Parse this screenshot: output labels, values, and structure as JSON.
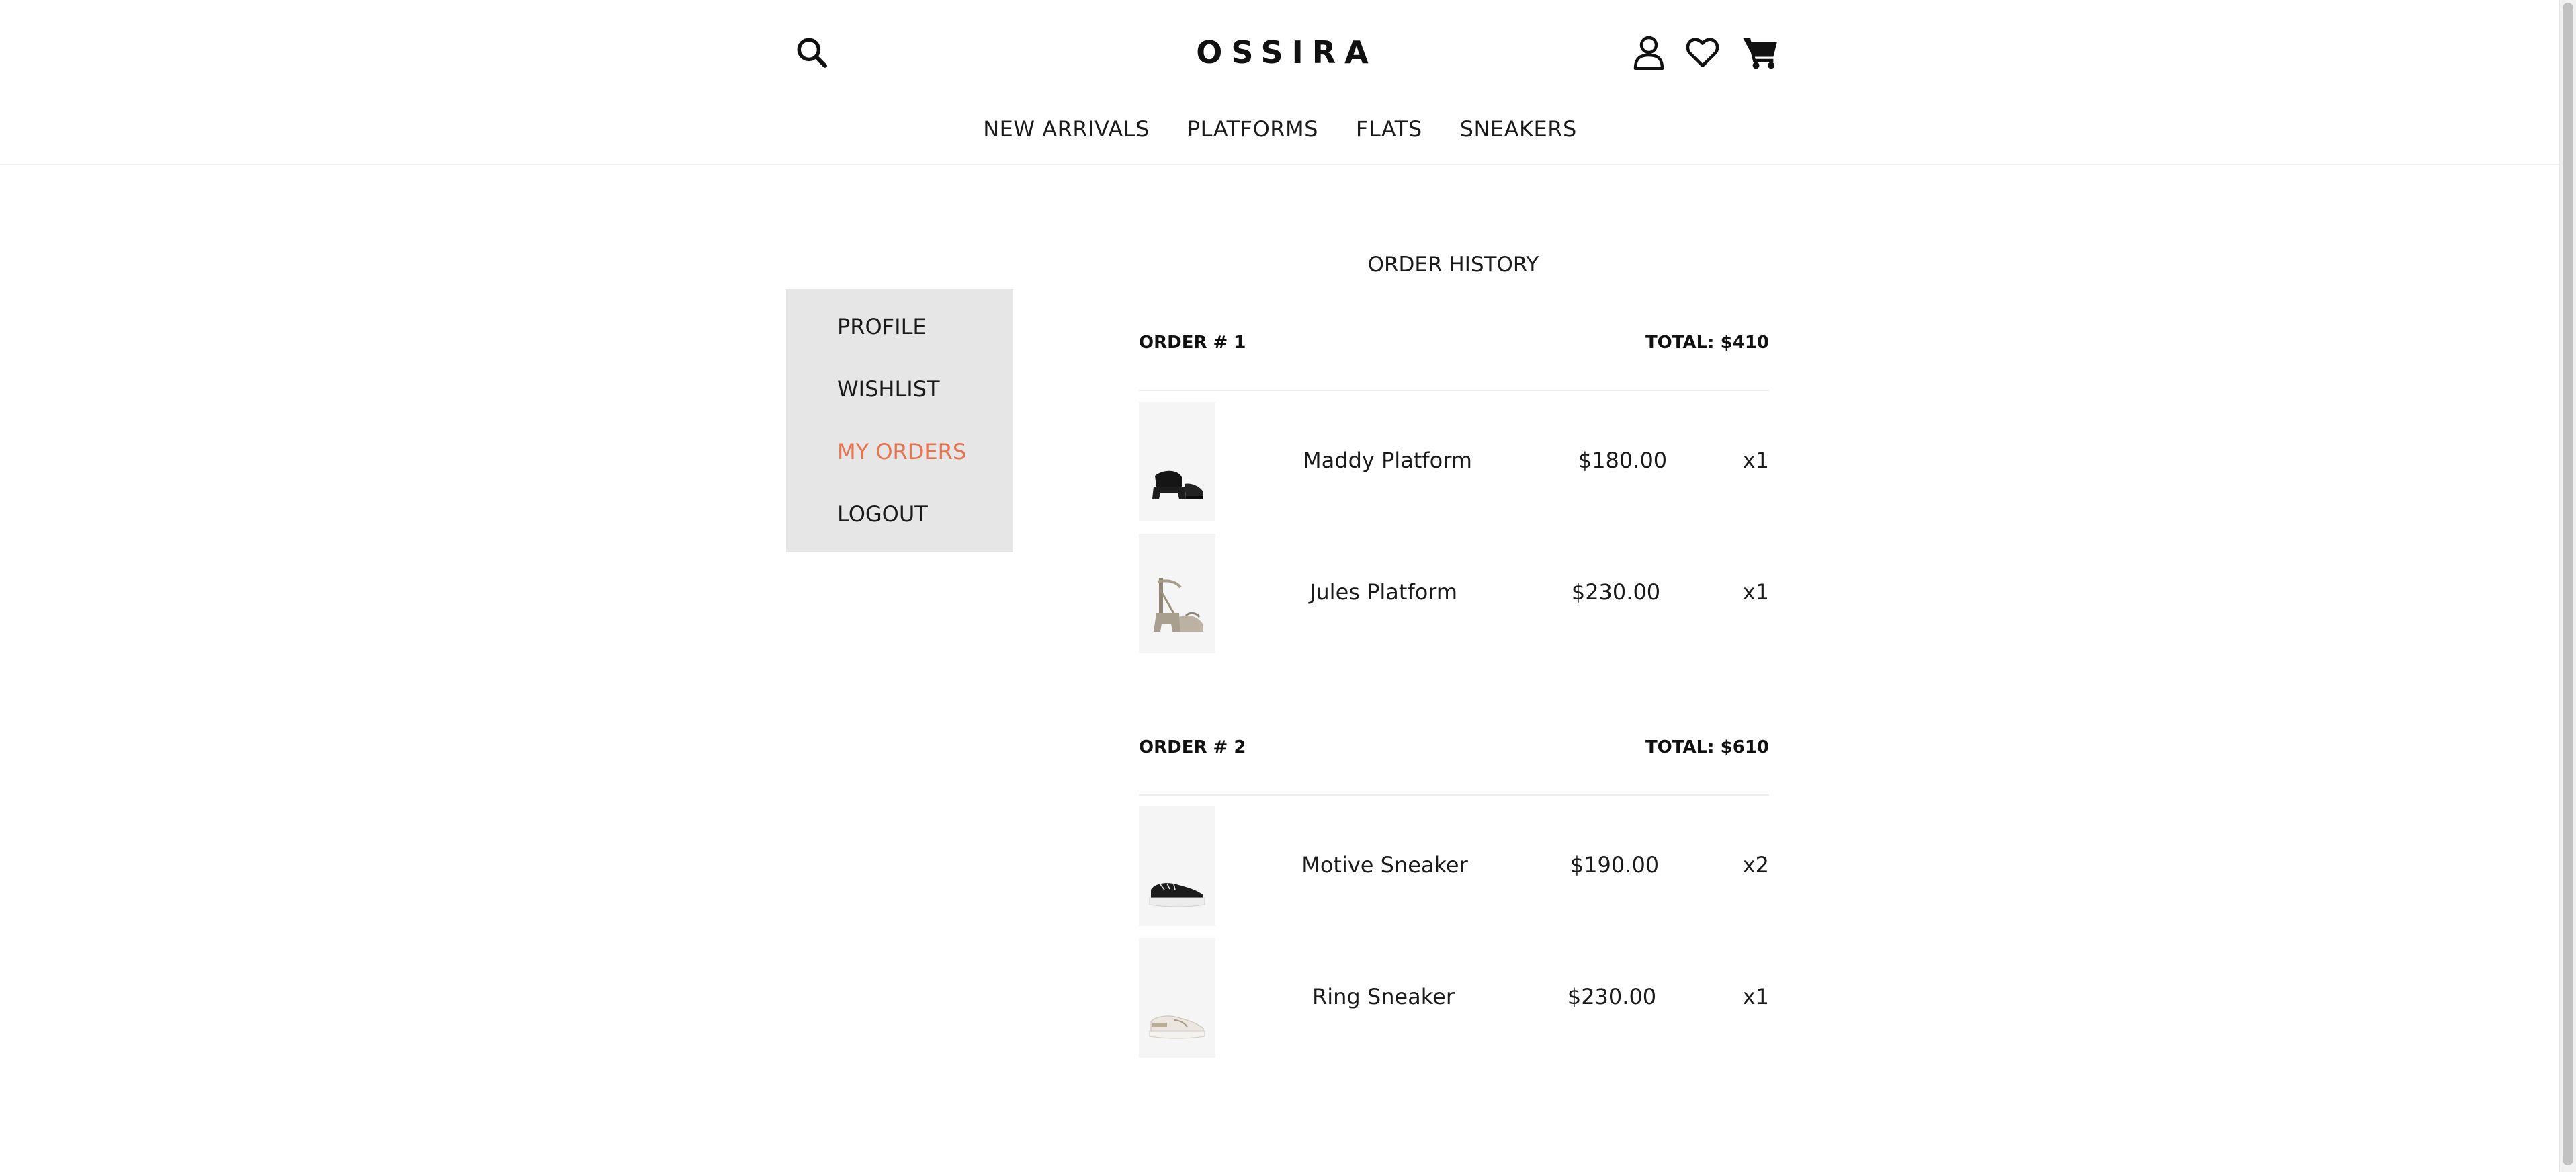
{
  "header": {
    "logo": "OSSIRA",
    "search_icon": "search-icon",
    "account_icon": "user-icon",
    "wishlist_icon": "heart-icon",
    "cart_icon": "cart-icon"
  },
  "nav": {
    "items": [
      {
        "label": "NEW ARRIVALS"
      },
      {
        "label": "PLATFORMS"
      },
      {
        "label": "FLATS"
      },
      {
        "label": "SNEAKERS"
      }
    ]
  },
  "sidebar": {
    "items": [
      {
        "label": "PROFILE"
      },
      {
        "label": "WISHLIST"
      },
      {
        "label": "MY ORDERS"
      },
      {
        "label": "LOGOUT"
      }
    ],
    "active": "MY ORDERS",
    "active_color": "#e8734f"
  },
  "main": {
    "title": "ORDER HISTORY",
    "orders": [
      {
        "label": "ORDER # 1",
        "total": "TOTAL: $410",
        "items": [
          {
            "name": "Maddy Platform",
            "price": "$180.00",
            "qty": "x1"
          },
          {
            "name": "Jules Platform",
            "price": "$230.00",
            "qty": "x1"
          }
        ]
      },
      {
        "label": "ORDER # 2",
        "total": "TOTAL: $610",
        "items": [
          {
            "name": "Motive Sneaker",
            "price": "$190.00",
            "qty": "x2"
          },
          {
            "name": "Ring Sneaker",
            "price": "$230.00",
            "qty": "x1"
          }
        ]
      }
    ]
  }
}
